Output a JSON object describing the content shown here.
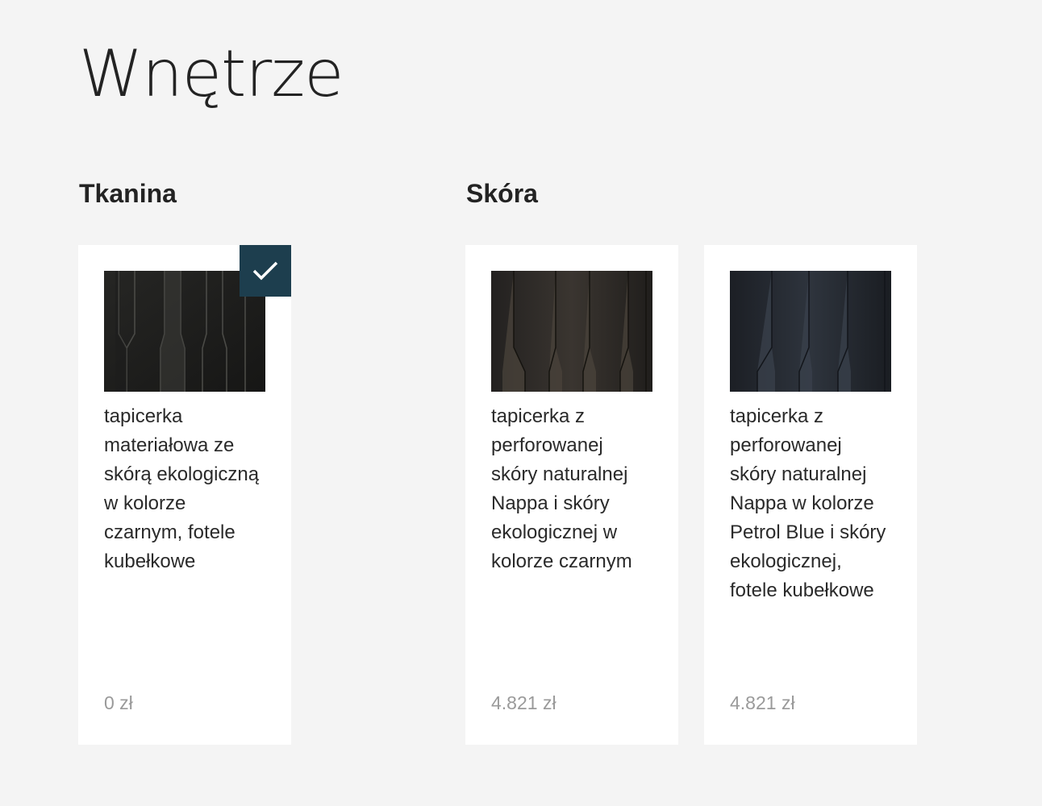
{
  "page": {
    "title": "Wnętrze"
  },
  "sections": [
    {
      "title": "Tkanina",
      "options": [
        {
          "description": "tapicerka materiałowa ze skórą ekologiczną w kolorze czarnym, fotele kubełkowe",
          "price": "0 zł",
          "selected": true,
          "swatch_color": "#2b2b29"
        }
      ]
    },
    {
      "title": "Skóra",
      "options": [
        {
          "description": "tapicerka z perforowanej skóry naturalnej Nappa i skóry ekologicznej w kolorze czarnym",
          "price": "4.821 zł",
          "selected": false,
          "swatch_color": "#2c2925"
        },
        {
          "description": "tapicerka z perforowanej skóry naturalnej Nappa w kolorze Petrol Blue i skóry ekologicznej, fotele kubełkowe",
          "price": "4.821 zł",
          "selected": false,
          "swatch_color": "#262a31"
        }
      ]
    }
  ],
  "colors": {
    "background": "#f4f4f4",
    "card": "#ffffff",
    "selected_badge": "#1d3e4e",
    "price": "#9a9a9a"
  },
  "icons": {
    "selected": "checkmark-icon"
  }
}
